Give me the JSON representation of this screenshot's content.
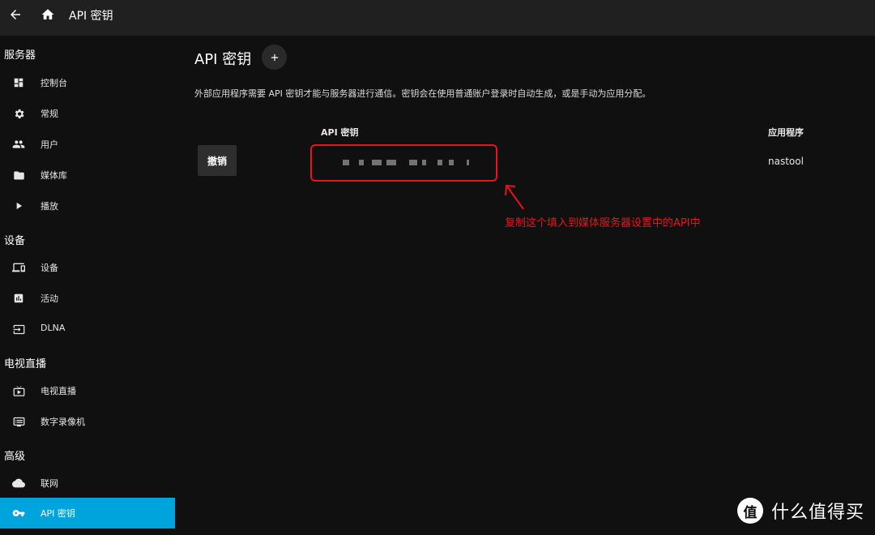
{
  "topbar": {
    "title": "API 密钥",
    "back_icon": "arrow-back-icon",
    "home_icon": "home-icon"
  },
  "sidebar": {
    "sections": [
      {
        "title": "服务器",
        "items": [
          {
            "label": "控制台",
            "icon": "dashboard-icon"
          },
          {
            "label": "常规",
            "icon": "gear-icon"
          },
          {
            "label": "用户",
            "icon": "people-icon"
          },
          {
            "label": "媒体库",
            "icon": "folder-icon"
          },
          {
            "label": "播放",
            "icon": "play-icon"
          }
        ]
      },
      {
        "title": "设备",
        "items": [
          {
            "label": "设备",
            "icon": "devices-icon"
          },
          {
            "label": "活动",
            "icon": "analytics-icon"
          },
          {
            "label": "DLNA",
            "icon": "input-icon"
          }
        ]
      },
      {
        "title": "电视直播",
        "items": [
          {
            "label": "电视直播",
            "icon": "live-tv-icon"
          },
          {
            "label": "数字录像机",
            "icon": "dvr-icon"
          }
        ]
      },
      {
        "title": "高级",
        "items": [
          {
            "label": "联网",
            "icon": "cloud-icon"
          },
          {
            "label": "API 密钥",
            "icon": "key-icon",
            "active": true
          }
        ]
      }
    ]
  },
  "main": {
    "title": "API 密钥",
    "add_icon": "plus-icon",
    "description": "外部应用程序需要 API 密钥才能与服务器进行通信。密钥会在使用普通账户登录时自动生成，或是手动为应用分配。",
    "table": {
      "headers": {
        "key": "API 密钥",
        "app": "应用程序"
      },
      "rows": [
        {
          "action": "撤销",
          "app": "nastool"
        }
      ]
    }
  },
  "annotation": {
    "text": "复制这个填入到媒体服务器设置中的API中",
    "color": "#e8141b"
  },
  "watermark": {
    "logo_text": "值",
    "text": "什么值得买"
  },
  "colors": {
    "accent": "#00a4dc",
    "background": "#101010",
    "topbar": "#202020",
    "highlight": "#e8141b"
  }
}
